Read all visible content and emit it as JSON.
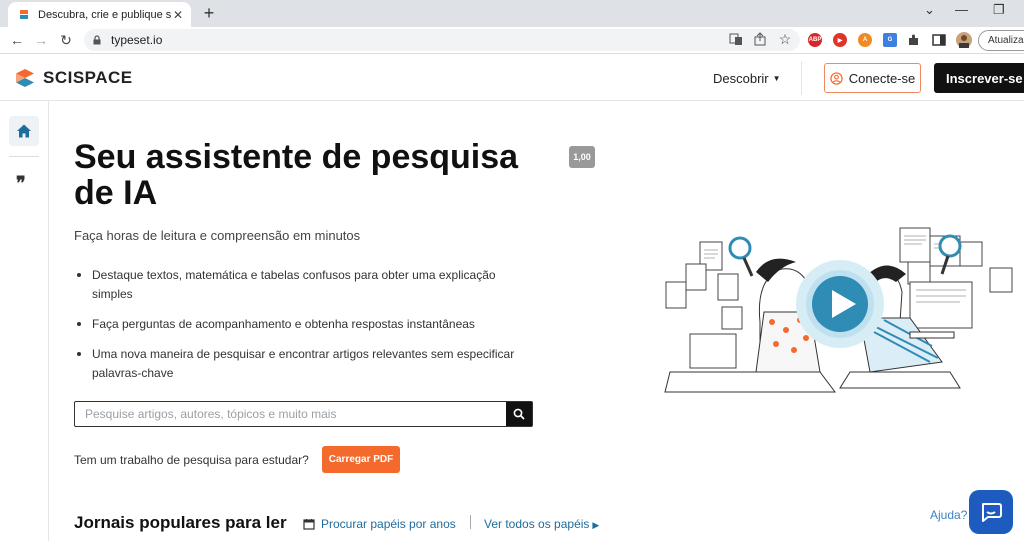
{
  "browser": {
    "tab_title": "Descubra, crie e publique seu tra",
    "url": "typeset.io",
    "update_label": "Atualizar"
  },
  "header": {
    "logo_text": "SCISPACE",
    "discover_label": "Descobrir",
    "login_label": "Conecte-se",
    "signup_label": "Inscrever-se"
  },
  "hero": {
    "title": "Seu assistente de pesquisa de IA",
    "version_badge": "1,00",
    "subtitle": "Faça horas de leitura e compreensão em minutos",
    "bullets": [
      "Destaque textos, matemática e tabelas confusos para obter uma explicação simples",
      "Faça perguntas de acompanhamento e obtenha respostas instantâneas",
      "Uma nova maneira de pesquisar e encontrar artigos relevantes sem especificar palavras-chave"
    ]
  },
  "search": {
    "placeholder": "Pesquise artigos, autores, tópicos e muito mais"
  },
  "upload": {
    "question": "Tem um trabalho de pesquisa para estudar?",
    "button_label": "Carregar PDF"
  },
  "journals": {
    "title": "Jornais populares para ler",
    "browse_by_year": "Procurar papéis por anos",
    "see_all": "Ver todos os papéis"
  },
  "help": {
    "label": "Ajuda?"
  },
  "colors": {
    "accent_orange": "#f46a2d",
    "link_blue": "#1f6d9c",
    "chat_blue": "#1e5bbf",
    "video_teal": "#2f8cb5"
  }
}
